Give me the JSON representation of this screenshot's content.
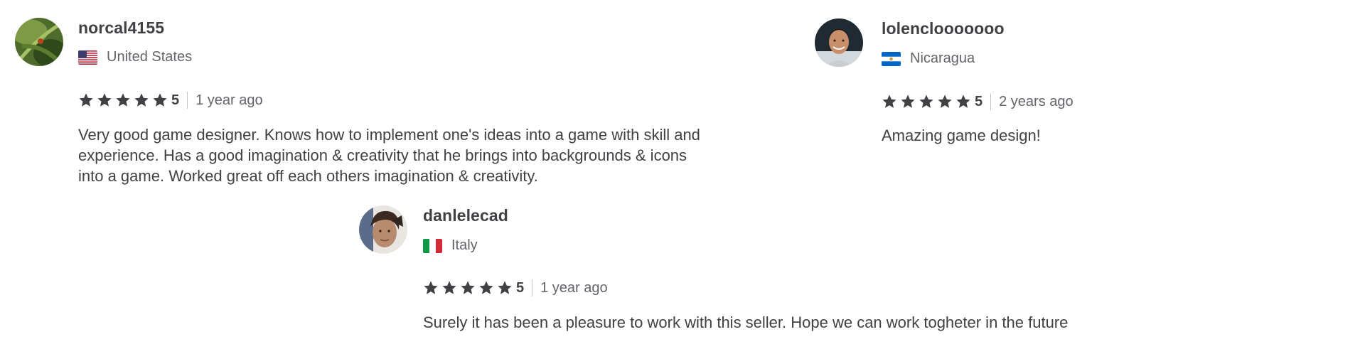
{
  "reviews": [
    {
      "username": "norcal4155",
      "country": "United States",
      "flag": "us-flag",
      "rating": "5",
      "stars": 5,
      "time": "1 year ago",
      "comment": "Very good game designer. Knows how to implement one's ideas into a game with skill and experience. Has a good imagination & creativity that he brings into backgrounds & icons into a game. Worked great off each others imagination & creativity."
    },
    {
      "username": "lolenclooooooo",
      "country": "Nicaragua",
      "flag": "nicaragua-flag",
      "rating": "5",
      "stars": 5,
      "time": "2 years ago",
      "comment": "Amazing game design!"
    },
    {
      "username": "danlelecad",
      "country": "Italy",
      "flag": "italy-flag",
      "rating": "5",
      "stars": 5,
      "time": "1 year ago",
      "comment": "Surely it has been a pleasure to work with this seller. Hope we can work togheter in the future"
    }
  ],
  "colors": {
    "text": "#404145",
    "muted": "#62646a",
    "star": "#404145",
    "divider": "#c5c6c9"
  },
  "icons": {
    "star": "star-icon"
  }
}
